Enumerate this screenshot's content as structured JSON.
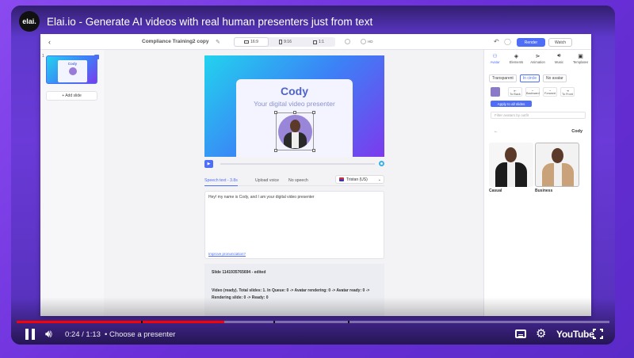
{
  "video": {
    "channel_logo": "elai.",
    "title": "Elai.io - Generate AI videos with real human presenters just from text"
  },
  "app": {
    "project_title": "Compliance Training2 copy",
    "ratios": [
      "16:9",
      "9:16",
      "1:1"
    ],
    "toggles": [
      "",
      "HD"
    ],
    "render_label": "Render",
    "watch_label": "Watch",
    "slide_number": "1",
    "thumb_name": "Cody",
    "add_slide_label": "+ Add slide",
    "canvas": {
      "name": "Cody",
      "subtitle": "Your digital video presenter"
    },
    "tabs": [
      "Speech text - 3.8s",
      "Upload voice",
      "No speech"
    ],
    "voice": "Tristan (US)",
    "speech_text": "Hey! my name is Cody, and I am your digital video presenter",
    "improve_label": "Improve pronunciation?",
    "status": {
      "slide_id": "Slide 1141935765694 - edited",
      "log": "Video (ready). Total slides: 1. In Queue: 0 -> Avatar rendering: 0 -> Avatar ready: 0 -> Rendering slide: 0 -> Ready: 0"
    },
    "right_panel": {
      "tabs": [
        "Avatar",
        "Elements",
        "Animation",
        "Music",
        "Templates"
      ],
      "modes": [
        "Transparent",
        "In circle",
        "No avatar"
      ],
      "positions": [
        "To Back",
        "Backward",
        "Forward",
        "To Front"
      ],
      "apply_label": "Apply to all slides",
      "filter_placeholder": "Filter avatars by outfit",
      "avatar_name": "Cody",
      "outfits": [
        "Casual",
        "Business"
      ]
    }
  },
  "player": {
    "progress_fraction": 0.35,
    "time": "0:24 / 1:13",
    "chapter": "• Choose a presenter",
    "brand": "YouTube"
  }
}
